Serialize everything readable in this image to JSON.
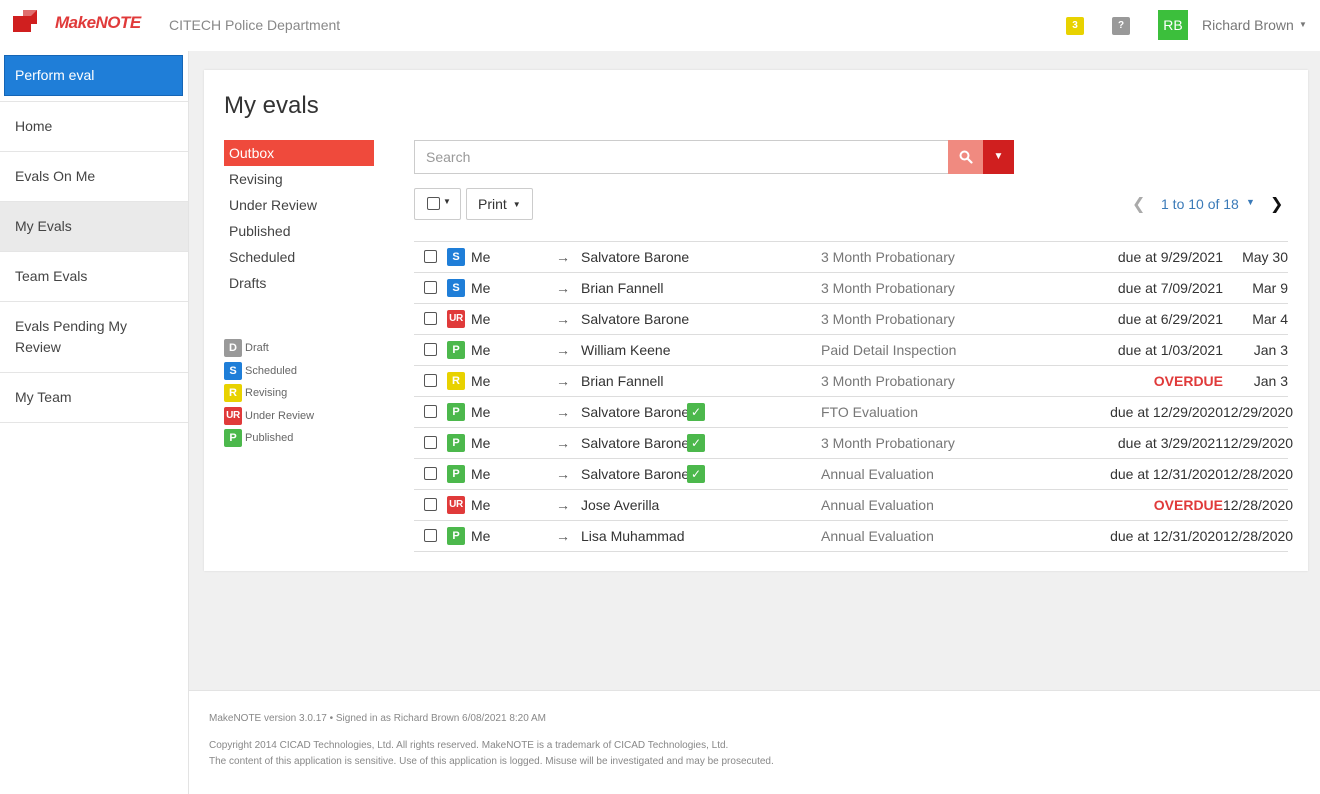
{
  "header": {
    "app_name": "MakeNOTE",
    "org_name": "CITECH Police Department",
    "notification_count": "3",
    "help_label": "?",
    "avatar_initials": "RB",
    "user_name": "Richard Brown",
    "brand_color": "#e03a3a"
  },
  "sidebar": {
    "perform_label": "Perform eval",
    "items": [
      {
        "label": "Home"
      },
      {
        "label": "Evals On Me"
      },
      {
        "label": "My Evals"
      },
      {
        "label": "Team Evals"
      },
      {
        "label": "Evals Pending My Review"
      },
      {
        "label": "My Team"
      }
    ]
  },
  "main": {
    "title": "My evals",
    "folders": [
      "Outbox",
      "Revising",
      "Under Review",
      "Published",
      "Scheduled",
      "Drafts"
    ],
    "legend": [
      {
        "code": "D",
        "label": "Draft"
      },
      {
        "code": "S",
        "label": "Scheduled"
      },
      {
        "code": "R",
        "label": "Revising"
      },
      {
        "code": "UR",
        "label": "Under Review"
      },
      {
        "code": "P",
        "label": "Published"
      }
    ],
    "search_placeholder": "Search",
    "print_label": "Print",
    "pager_text": "1 to 10 of 18",
    "rows": [
      {
        "status": "S",
        "from": "Me",
        "arrow": "→",
        "to": "Salvatore Barone",
        "ok": "",
        "type": "3 Month Probationary",
        "due": "due at 9/29/2021",
        "overdue": false,
        "date": "May 30"
      },
      {
        "status": "S",
        "from": "Me",
        "arrow": "→",
        "to": "Brian Fannell",
        "ok": "",
        "type": "3 Month Probationary",
        "due": "due at 7/09/2021",
        "overdue": false,
        "date": "Mar 9"
      },
      {
        "status": "UR",
        "from": "Me",
        "arrow": "→",
        "to": "Salvatore Barone",
        "ok": "",
        "type": "3 Month Probationary",
        "due": "due at 6/29/2021",
        "overdue": false,
        "date": "Mar 4"
      },
      {
        "status": "P",
        "from": "Me",
        "arrow": "→",
        "to": "William Keene",
        "ok": "",
        "type": "Paid Detail Inspection",
        "due": "due at 1/03/2021",
        "overdue": false,
        "date": "Jan 3"
      },
      {
        "status": "R",
        "from": "Me",
        "arrow": "→",
        "to": "Brian Fannell",
        "ok": "",
        "type": "3 Month Probationary",
        "due": "OVERDUE",
        "overdue": true,
        "date": "Jan 3"
      },
      {
        "status": "P",
        "from": "Me",
        "arrow": "→",
        "to": "Salvatore Barone",
        "ok": "✓",
        "type": "FTO Evaluation",
        "due": "due at 12/29/2020",
        "overdue": false,
        "date": "12/29/2020"
      },
      {
        "status": "P",
        "from": "Me",
        "arrow": "→",
        "to": "Salvatore Barone",
        "ok": "✓",
        "type": "3 Month Probationary",
        "due": "due at 3/29/2021",
        "overdue": false,
        "date": "12/29/2020"
      },
      {
        "status": "P",
        "from": "Me",
        "arrow": "→",
        "to": "Salvatore Barone",
        "ok": "✓",
        "type": "Annual Evaluation",
        "due": "due at 12/31/2020",
        "overdue": false,
        "date": "12/28/2020"
      },
      {
        "status": "UR",
        "from": "Me",
        "arrow": "→",
        "to": "Jose Averilla",
        "ok": "",
        "type": "Annual Evaluation",
        "due": "OVERDUE",
        "overdue": true,
        "date": "12/28/2020"
      },
      {
        "status": "P",
        "from": "Me",
        "arrow": "→",
        "to": "Lisa Muhammad",
        "ok": "",
        "type": "Annual Evaluation",
        "due": "due at 12/31/2020",
        "overdue": false,
        "date": "12/28/2020"
      }
    ]
  },
  "footer": {
    "version": "MakeNOTE version 3.0.17 • Signed in as Richard Brown 6/08/2021 8:20 AM",
    "copyright": "Copyright 2014 CICAD Technologies, Ltd. All rights reserved. MakeNOTE is a trademark of CICAD Technologies, Ltd.",
    "notice": "The content of this application is sensitive. Use of this application is logged. Misuse will be investigated and may be prosecuted."
  }
}
